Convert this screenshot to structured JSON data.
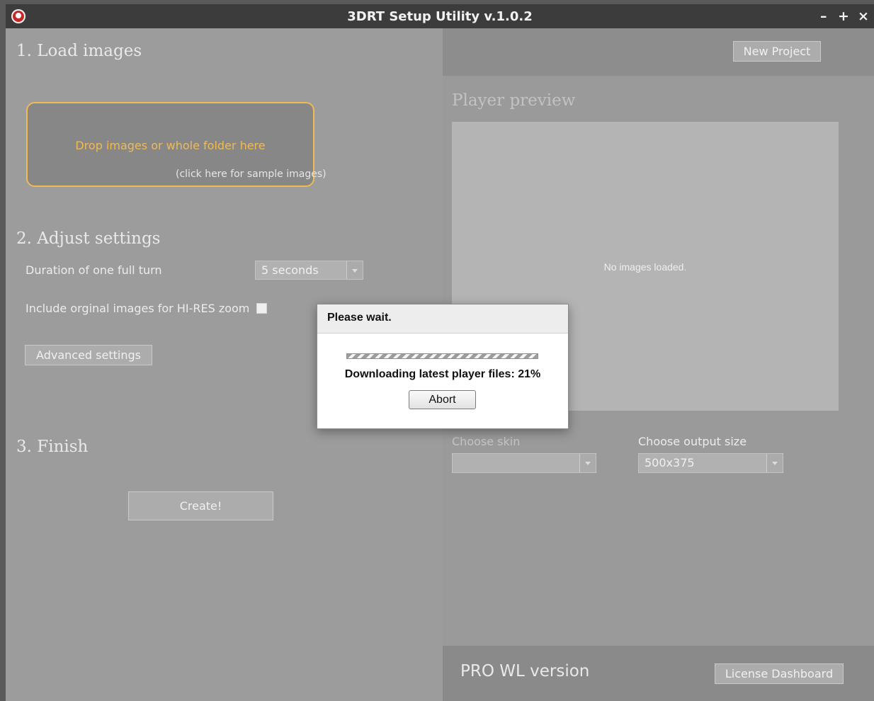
{
  "window": {
    "title": "3DRT Setup Utility v.1.0.2",
    "controls": {
      "minimize": "–",
      "maximize": "+",
      "close": "×"
    }
  },
  "left": {
    "section1": {
      "heading": "1. Load images",
      "dropzone_text": "Drop images or whole folder here",
      "sample_link": "(click here for sample images)"
    },
    "section2": {
      "heading": "2. Adjust settings",
      "duration_label": "Duration of one full turn",
      "duration_value": "5 seconds",
      "include_label": "Include orginal images for HI-RES zoom",
      "include_checked": false,
      "advanced_button": "Advanced settings"
    },
    "section3": {
      "heading": "3. Finish",
      "create_button": "Create!"
    }
  },
  "right": {
    "new_project_button": "New Project",
    "preview_heading": "Player preview",
    "preview_message": "No images loaded.",
    "skin_label": "Choose skin",
    "skin_value": "",
    "output_label": "Choose output size",
    "output_value": "500x375",
    "version_label": "PRO WL version",
    "license_button": "License Dashboard"
  },
  "modal": {
    "title": "Please wait.",
    "status": "Downloading latest player files: 21%",
    "progress_fraction": 0.21,
    "abort_button": "Abort"
  },
  "colors": {
    "accent": "#f0ba55",
    "titlebar": "#3c3c3c",
    "panel": "#9c9c9c"
  }
}
